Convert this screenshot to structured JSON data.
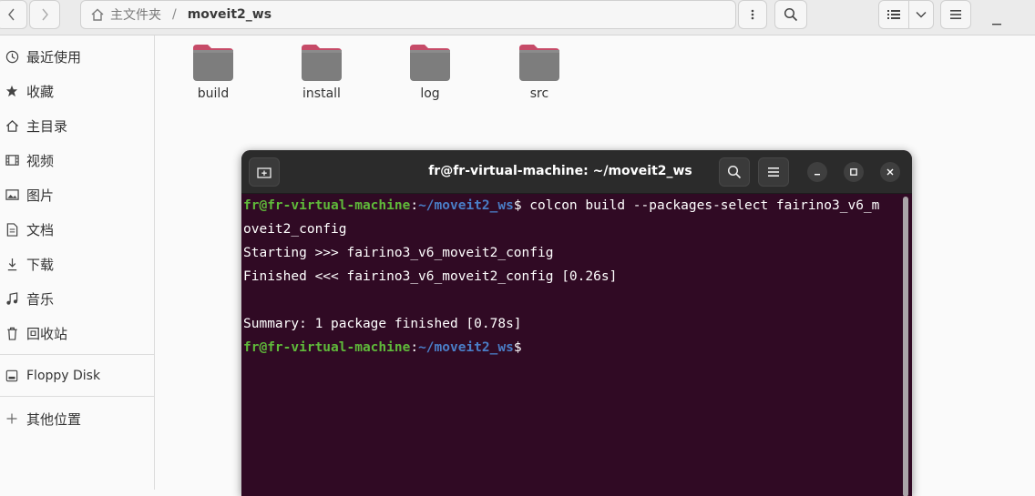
{
  "header": {
    "path": {
      "home_label": "主文件夹",
      "separator": "/",
      "current": "moveit2_ws"
    }
  },
  "sidebar": {
    "items": [
      {
        "label": "最近使用",
        "icon": "clock-icon"
      },
      {
        "label": "收藏",
        "icon": "star-icon"
      },
      {
        "label": "主目录",
        "icon": "home-icon"
      },
      {
        "label": "视频",
        "icon": "film-icon"
      },
      {
        "label": "图片",
        "icon": "image-icon"
      },
      {
        "label": "文档",
        "icon": "document-icon"
      },
      {
        "label": "下载",
        "icon": "download-icon"
      },
      {
        "label": "音乐",
        "icon": "music-icon"
      },
      {
        "label": "回收站",
        "icon": "trash-icon"
      }
    ],
    "devices": [
      {
        "label": "Floppy Disk",
        "icon": "drive-icon"
      }
    ],
    "other": {
      "label": "其他位置",
      "icon": "plus-icon"
    }
  },
  "folders": [
    {
      "name": "build"
    },
    {
      "name": "install"
    },
    {
      "name": "log"
    },
    {
      "name": "src"
    }
  ],
  "terminal": {
    "title": "fr@fr-virtual-machine: ~/moveit2_ws",
    "lines": [
      {
        "user": "fr@fr-virtual-machine",
        "colon": ":",
        "path": "~/moveit2_ws",
        "rest": "$ colcon build --packages-select fairino3_v6_m"
      },
      {
        "text": "oveit2_config"
      },
      {
        "text": "Starting >>> fairino3_v6_moveit2_config"
      },
      {
        "text": "Finished <<< fairino3_v6_moveit2_config [0.26s]"
      },
      {
        "text": ""
      },
      {
        "text": "Summary: 1 package finished [0.78s]"
      },
      {
        "user": "fr@fr-virtual-machine",
        "colon": ":",
        "path": "~/moveit2_ws",
        "rest": "$"
      }
    ]
  },
  "colors": {
    "terminal_bg": "#300a24",
    "prompt_user": "#5fba3a",
    "prompt_path": "#4a7ec7",
    "folder_tab": "#c64b68",
    "folder_body": "#7d7d7d"
  }
}
